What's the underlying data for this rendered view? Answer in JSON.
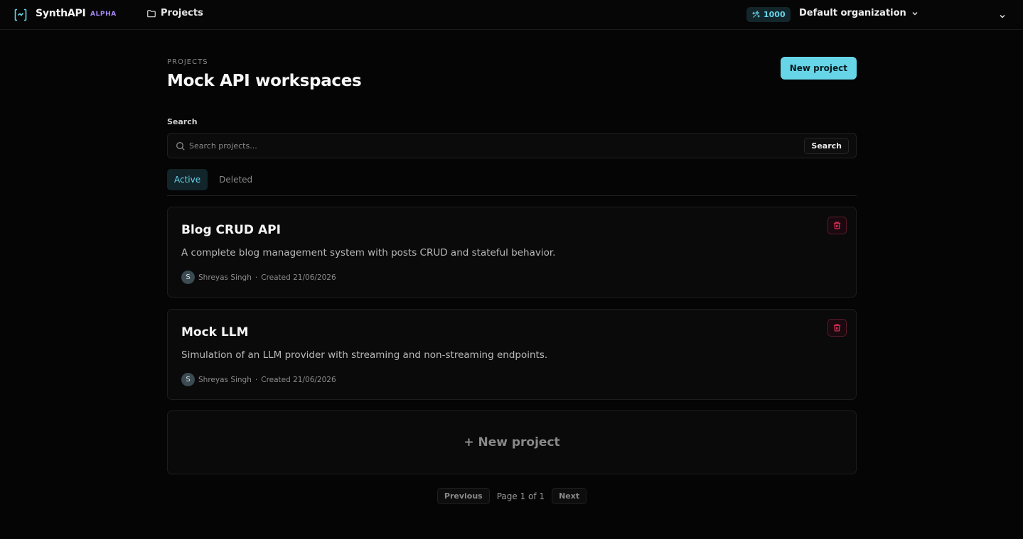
{
  "header": {
    "brand": "SynthAPI",
    "badge": "ALPHA",
    "nav_projects": "Projects",
    "credits": "1000",
    "organization": "Default organization"
  },
  "page": {
    "eyebrow": "PROJECTS",
    "title": "Mock API workspaces",
    "new_project_label": "New project"
  },
  "search": {
    "label": "Search",
    "placeholder": "Search projects...",
    "button_label": "Search"
  },
  "tabs": [
    {
      "label": "Active",
      "active": true
    },
    {
      "label": "Deleted",
      "active": false
    }
  ],
  "projects": [
    {
      "title": "Blog CRUD API",
      "description": "A complete blog management system with posts CRUD and stateful behavior.",
      "author_initial": "S",
      "author": "Shreyas Singh",
      "separator": "·",
      "created": "Created 21/06/2026"
    },
    {
      "title": "Mock LLM",
      "description": "Simulation of an LLM provider with streaming and non-streaming endpoints.",
      "author_initial": "S",
      "author": "Shreyas Singh",
      "separator": "·",
      "created": "Created 21/06/2026"
    }
  ],
  "new_project_card": "+ New project",
  "pagination": {
    "previous": "Previous",
    "info": "Page 1 of 1",
    "next": "Next"
  },
  "colors": {
    "accent": "#67d5e8",
    "badge": "#a78bfa",
    "danger": "#e0305a"
  }
}
